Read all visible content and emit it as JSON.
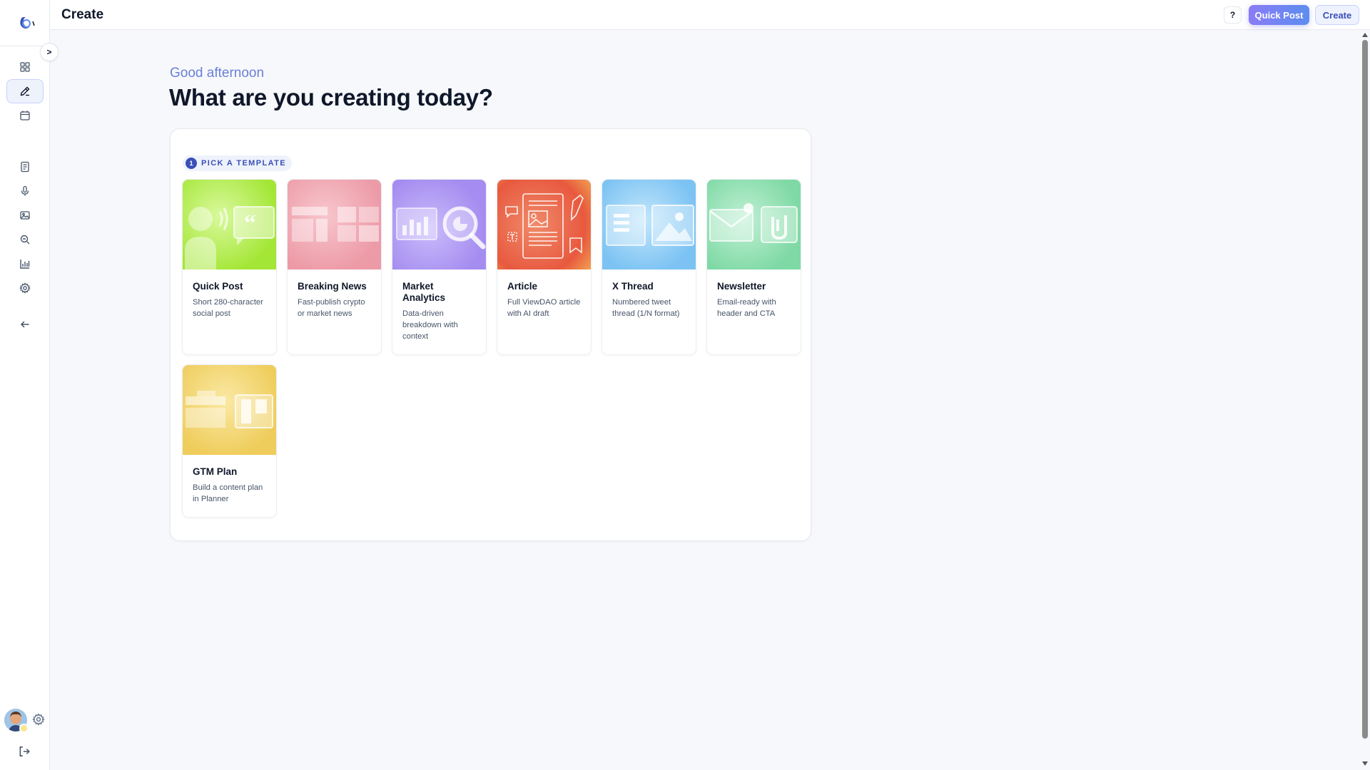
{
  "header": {
    "title": "Create",
    "help_label": "?",
    "quick_post_label": "Quick Post",
    "create_label": "Create"
  },
  "sidebar": {
    "collapse_label": ">",
    "items": [
      {
        "name": "dashboard",
        "icon": "grid-icon"
      },
      {
        "name": "create",
        "icon": "pen-icon",
        "active": true
      },
      {
        "name": "calendar",
        "icon": "calendar-icon"
      },
      {
        "name": "documents",
        "icon": "document-icon"
      },
      {
        "name": "audio",
        "icon": "microphone-icon"
      },
      {
        "name": "images",
        "icon": "image-icon"
      },
      {
        "name": "research",
        "icon": "search-icon"
      },
      {
        "name": "analytics",
        "icon": "chart-icon"
      },
      {
        "name": "settings",
        "icon": "gear-icon"
      },
      {
        "name": "back",
        "icon": "arrow-left-icon"
      }
    ]
  },
  "main": {
    "greeting": "Good afternoon",
    "headline": "What are you creating today?",
    "step": {
      "number": "1",
      "label": "PICK A TEMPLATE"
    },
    "templates": [
      {
        "title": "Quick Post",
        "description": "Short 280-character social post",
        "color": "#a3e635"
      },
      {
        "title": "Breaking News",
        "description": "Fast-publish crypto or market news",
        "color": "#f0a1ab"
      },
      {
        "title": "Market Analytics",
        "description": "Data-driven breakdown with context",
        "color": "#b9a6f5"
      },
      {
        "title": "Article",
        "description": "Full ViewDAO article with AI draft",
        "color": "#ec6a52"
      },
      {
        "title": "X Thread",
        "description": "Numbered tweet thread (1/N format)",
        "color": "#8fcdf6"
      },
      {
        "title": "Newsletter",
        "description": "Email-ready with header and CTA",
        "color": "#8fe0b3"
      },
      {
        "title": "GTM Plan",
        "description": "Build a content plan in Planner",
        "color": "#f1d067"
      }
    ]
  },
  "colors": {
    "accent": "#3b4fb8",
    "greeting": "#6b7fd6",
    "quick_post_gradient": [
      "#8b7cf6",
      "#5b8def"
    ]
  }
}
